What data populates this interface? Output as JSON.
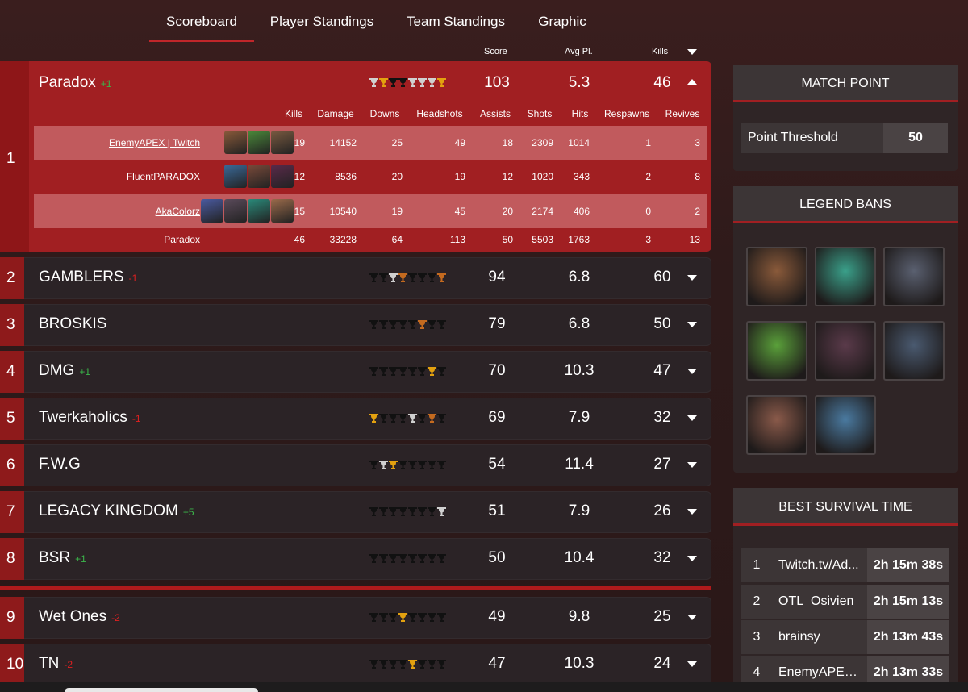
{
  "tabs": [
    "Scoreboard",
    "Player Standings",
    "Team Standings",
    "Graphic"
  ],
  "columns": {
    "score": "Score",
    "avg": "Avg Pl.",
    "kills": "Kills"
  },
  "expanded": {
    "rank": "1",
    "name": "Paradox",
    "delta": "+1",
    "score": "103",
    "avg": "5.3",
    "kills": "46",
    "trophies": [
      "silver",
      "gold",
      "dark",
      "dark",
      "silver",
      "silver",
      "silver",
      "gold"
    ],
    "stat_headers": [
      "Kills",
      "Damage",
      "Downs",
      "Headshots",
      "Assists",
      "Shots",
      "Hits",
      "Respawns",
      "Revives"
    ],
    "players": [
      {
        "name": "EnemyAPEX | Twitch",
        "stats": [
          "19",
          "14152",
          "25",
          "49",
          "18",
          "2309",
          "1014",
          "1",
          "3"
        ],
        "legends": [
          "#8a5a3a",
          "#4b8a3a",
          "#7a5a40"
        ]
      },
      {
        "name": "FluentPARADOX",
        "stats": [
          "12",
          "8536",
          "20",
          "19",
          "12",
          "1020",
          "343",
          "2",
          "8"
        ],
        "legends": [
          "#3a6a9a",
          "#7a4a3a",
          "#5a2a4a"
        ]
      },
      {
        "name": "AkaColorz",
        "stats": [
          "15",
          "10540",
          "19",
          "45",
          "20",
          "2174",
          "406",
          "0",
          "2"
        ],
        "legends": [
          "#4a5aa0",
          "#5a4a5a",
          "#2a8a7a",
          "#9a6a4a"
        ]
      }
    ],
    "totals": {
      "name": "Paradox",
      "stats": [
        "46",
        "33228",
        "64",
        "113",
        "50",
        "5503",
        "1763",
        "3",
        "13"
      ]
    }
  },
  "rows": [
    {
      "rank": "2",
      "name": "GAMBLERS",
      "delta": "-1",
      "dir": "down",
      "score": "94",
      "avg": "6.8",
      "kills": "60",
      "trophies": [
        "dark",
        "dark",
        "silver",
        "bronze",
        "dark",
        "dark",
        "dark",
        "bronze"
      ]
    },
    {
      "rank": "3",
      "name": "BROSKIS",
      "delta": "",
      "dir": "",
      "score": "79",
      "avg": "6.8",
      "kills": "50",
      "trophies": [
        "dark",
        "dark",
        "dark",
        "dark",
        "dark",
        "bronze",
        "dark",
        "dark"
      ]
    },
    {
      "rank": "4",
      "name": "DMG",
      "delta": "+1",
      "dir": "up",
      "score": "70",
      "avg": "10.3",
      "kills": "47",
      "trophies": [
        "dark",
        "dark",
        "dark",
        "dark",
        "dark",
        "dark",
        "gold",
        "dark"
      ]
    },
    {
      "rank": "5",
      "name": "Twerkaholics",
      "delta": "-1",
      "dir": "down",
      "score": "69",
      "avg": "7.9",
      "kills": "32",
      "trophies": [
        "gold",
        "dark",
        "dark",
        "dark",
        "silver",
        "dark",
        "bronze",
        "dark"
      ]
    },
    {
      "rank": "6",
      "name": "F.W.G",
      "delta": "",
      "dir": "",
      "score": "54",
      "avg": "11.4",
      "kills": "27",
      "trophies": [
        "dark",
        "silver",
        "gold",
        "dark",
        "dark",
        "dark",
        "dark",
        "dark"
      ]
    },
    {
      "rank": "7",
      "name": "LEGACY KINGDOM",
      "delta": "+5",
      "dir": "up",
      "score": "51",
      "avg": "7.9",
      "kills": "26",
      "trophies": [
        "dark",
        "dark",
        "dark",
        "dark",
        "dark",
        "dark",
        "dark",
        "silver"
      ]
    },
    {
      "rank": "8",
      "name": "BSR",
      "delta": "+1",
      "dir": "up",
      "score": "50",
      "avg": "10.4",
      "kills": "32",
      "trophies": [
        "dark",
        "dark",
        "dark",
        "dark",
        "dark",
        "dark",
        "dark",
        "dark"
      ]
    },
    {
      "rank": "9",
      "name": "Wet Ones",
      "delta": "-2",
      "dir": "down",
      "score": "49",
      "avg": "9.8",
      "kills": "25",
      "trophies": [
        "dark",
        "dark",
        "dark",
        "gold",
        "dark",
        "dark",
        "dark",
        "dark"
      ]
    },
    {
      "rank": "10",
      "name": "TN",
      "delta": "-2",
      "dir": "down",
      "score": "47",
      "avg": "10.3",
      "kills": "24",
      "trophies": [
        "dark",
        "dark",
        "dark",
        "dark",
        "gold",
        "dark",
        "dark",
        "dark"
      ]
    }
  ],
  "match_point": {
    "title": "MATCH POINT",
    "label": "Point Threshold",
    "value": "50"
  },
  "legend_bans": {
    "title": "LEGEND BANS",
    "colors": [
      "#8a5a3a",
      "#3aa08a",
      "#5a6070",
      "#5aa03a",
      "#5a3a4a",
      "#4a5a70",
      "#8a5a4a",
      "#4a7aa0"
    ]
  },
  "survival": {
    "title": "BEST SURVIVAL TIME",
    "rows": [
      {
        "rank": "1",
        "name": "Twitch.tv/Ad...",
        "time": "2h 15m 38s"
      },
      {
        "rank": "2",
        "name": "OTL_Osivien",
        "time": "2h 15m 13s"
      },
      {
        "rank": "3",
        "name": "brainsy",
        "time": "2h 13m 43s"
      },
      {
        "rank": "4",
        "name": "EnemyAPEX ...",
        "time": "2h 13m 33s"
      }
    ]
  }
}
